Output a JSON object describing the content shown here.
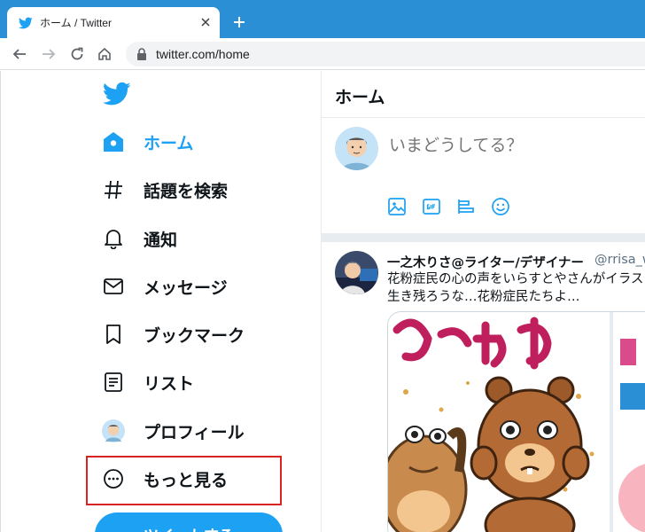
{
  "browser": {
    "tab_title": "ホーム / Twitter",
    "url": "twitter.com/home"
  },
  "sidebar": {
    "items": [
      {
        "label": "ホーム",
        "icon": "home-icon",
        "active": true
      },
      {
        "label": "話題を検索",
        "icon": "hashtag-icon"
      },
      {
        "label": "通知",
        "icon": "bell-icon"
      },
      {
        "label": "メッセージ",
        "icon": "mail-icon"
      },
      {
        "label": "ブックマーク",
        "icon": "bookmark-icon"
      },
      {
        "label": "リスト",
        "icon": "list-icon"
      },
      {
        "label": "プロフィール",
        "icon": "avatar"
      },
      {
        "label": "もっと見る",
        "icon": "more-circle-icon"
      }
    ],
    "tweet_button_label": "ツイートする"
  },
  "main": {
    "title": "ホーム",
    "composer": {
      "placeholder": "いまどうしてる？"
    },
    "tweet": {
      "name": "一之木りさ@ライター/デザイナー",
      "handle": "@rrisa_w",
      "text_line1": "花粉症民の心の声をいらすとやさんがイラス",
      "text_line2": "生き残ろうな…花粉症民たちよ…"
    }
  },
  "colors": {
    "accent": "#1da1f2",
    "chrome": "#2a8fd4",
    "highlight": "#d92323"
  }
}
